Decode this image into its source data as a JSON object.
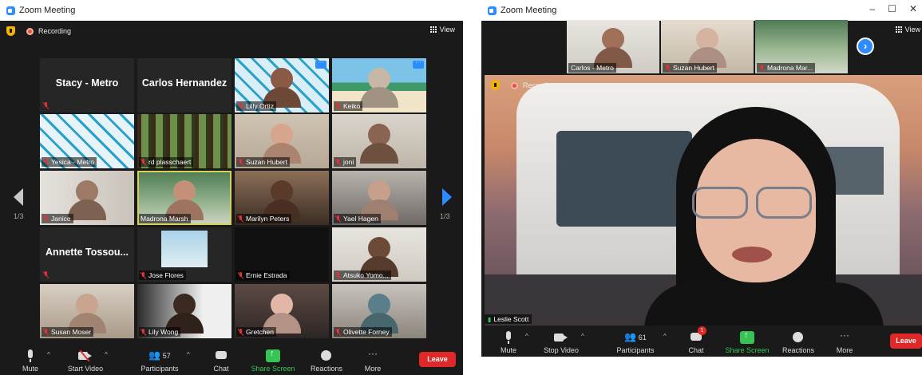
{
  "left_window": {
    "title": "Zoom Meeting",
    "recording_label": "Recording",
    "view_label": "View",
    "page_indicator_left": "1/3",
    "page_indicator_right": "1/3",
    "tiles": [
      {
        "name": "Stacy - Metro",
        "kind": "name"
      },
      {
        "name": "Carlos Hernandez",
        "kind": "name"
      },
      {
        "name": "Lilly Ortiz",
        "kind": "video"
      },
      {
        "name": "Keiko",
        "kind": "video"
      },
      {
        "name": "Yesica - Metro",
        "kind": "video"
      },
      {
        "name": "rd plasschaert",
        "kind": "video"
      },
      {
        "name": "Suzan Hubert",
        "kind": "video"
      },
      {
        "name": "joni",
        "kind": "video"
      },
      {
        "name": "Janice",
        "kind": "video"
      },
      {
        "name": "Madrona Marsh",
        "kind": "video"
      },
      {
        "name": "Marilyn Peters",
        "kind": "video"
      },
      {
        "name": "Yael Hagen",
        "kind": "video"
      },
      {
        "name": "Annette  Tossou...",
        "kind": "name"
      },
      {
        "name": "Jose Flores",
        "kind": "video"
      },
      {
        "name": "Ernie Estrada",
        "kind": "video"
      },
      {
        "name": "Atsuko Yomo...",
        "kind": "video"
      },
      {
        "name": "Susan Moser",
        "kind": "video"
      },
      {
        "name": "Lily Wong",
        "kind": "video"
      },
      {
        "name": "Gretchen",
        "kind": "video"
      },
      {
        "name": "Olivette Forney",
        "kind": "video"
      }
    ],
    "toolbar": {
      "mute": "Mute",
      "start_video": "Start Video",
      "participants": "Participants",
      "participants_count": "57",
      "chat": "Chat",
      "share_screen": "Share Screen",
      "reactions": "Reactions",
      "more": "More",
      "leave": "Leave"
    }
  },
  "right_window": {
    "title": "Zoom Meeting",
    "recording_label": "Recording",
    "view_label": "View",
    "strip": [
      {
        "name": "Carlos - Metro"
      },
      {
        "name": "Suzan Hubert"
      },
      {
        "name": "Madrona Mar..."
      }
    ],
    "speaker_name": "Leslie Scott",
    "toolbar": {
      "mute": "Mute",
      "stop_video": "Stop Video",
      "participants": "Participants",
      "participants_count": "61",
      "chat": "Chat",
      "chat_badge": "1",
      "share_screen": "Share Screen",
      "reactions": "Reactions",
      "more": "More",
      "leave": "Leave"
    }
  },
  "colors": {
    "accent_blue": "#2d8cff",
    "share_green": "#36c554",
    "leave_red": "#e02828",
    "muted_red": "#e0303a",
    "active_speaker": "#d8d05b"
  }
}
